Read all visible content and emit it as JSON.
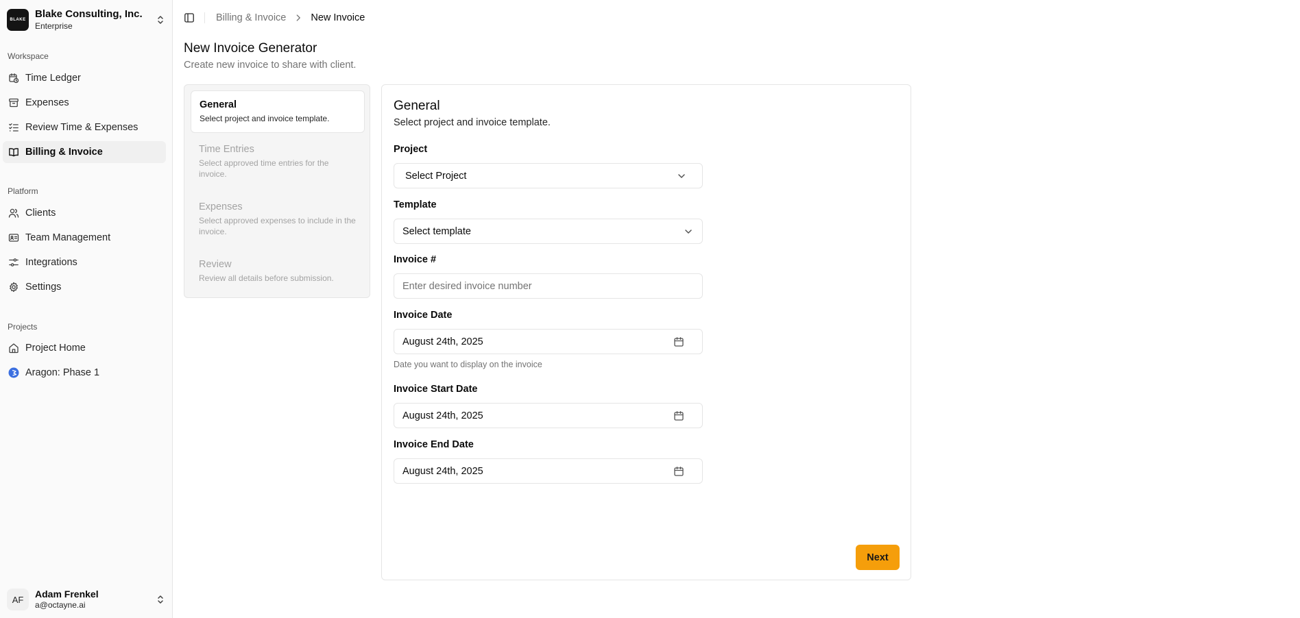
{
  "org": {
    "logo_text": "BLAKE",
    "name": "Blake Consulting, Inc.",
    "plan": "Enterprise"
  },
  "sidebar": {
    "workspace_label": "Workspace",
    "workspace_items": [
      {
        "label": "Time Ledger",
        "icon": "calendar-clock-icon"
      },
      {
        "label": "Expenses",
        "icon": "archive-icon"
      },
      {
        "label": "Review Time & Expenses",
        "icon": "list-check-icon"
      },
      {
        "label": "Billing & Invoice",
        "icon": "book-open-icon",
        "active": true
      }
    ],
    "platform_label": "Platform",
    "platform_items": [
      {
        "label": "Clients",
        "icon": "users-icon"
      },
      {
        "label": "Team Management",
        "icon": "id-card-icon"
      },
      {
        "label": "Integrations",
        "icon": "sliders-icon"
      },
      {
        "label": "Settings",
        "icon": "gear-icon"
      }
    ],
    "projects_label": "Projects",
    "project_items": [
      {
        "label": "Project Home",
        "icon": "home-icon"
      },
      {
        "label": "Aragon: Phase 1",
        "icon": "project-logo-icon"
      }
    ]
  },
  "user": {
    "initials": "AF",
    "name": "Adam Frenkel",
    "email": "a@octayne.ai"
  },
  "breadcrumb": {
    "parent": "Billing & Invoice",
    "current": "New Invoice"
  },
  "header": {
    "title": "New Invoice Generator",
    "subtitle": "Create new invoice to share with client."
  },
  "steps": [
    {
      "title": "General",
      "desc": "Select project and invoice template.",
      "active": true
    },
    {
      "title": "Time Entries",
      "desc": "Select approved time entries for the invoice."
    },
    {
      "title": "Expenses",
      "desc": "Select approved expenses to include in the invoice."
    },
    {
      "title": "Review",
      "desc": "Review all details before submission."
    }
  ],
  "form": {
    "title": "General",
    "subtitle": "Select project and invoice template.",
    "project_label": "Project",
    "project_value": "Select Project",
    "template_label": "Template",
    "template_value": "Select template",
    "invoice_number_label": "Invoice #",
    "invoice_number_placeholder": "Enter desired invoice number",
    "invoice_date_label": "Invoice Date",
    "invoice_date_value": "August 24th, 2025",
    "invoice_date_help": "Date you want to display on the invoice",
    "start_date_label": "Invoice Start Date",
    "start_date_value": "August 24th, 2025",
    "end_date_label": "Invoice End Date",
    "end_date_value": "August 24th, 2025",
    "next_label": "Next"
  },
  "colors": {
    "accent": "#f59e0b",
    "project_logo": "#3b6fe0"
  }
}
